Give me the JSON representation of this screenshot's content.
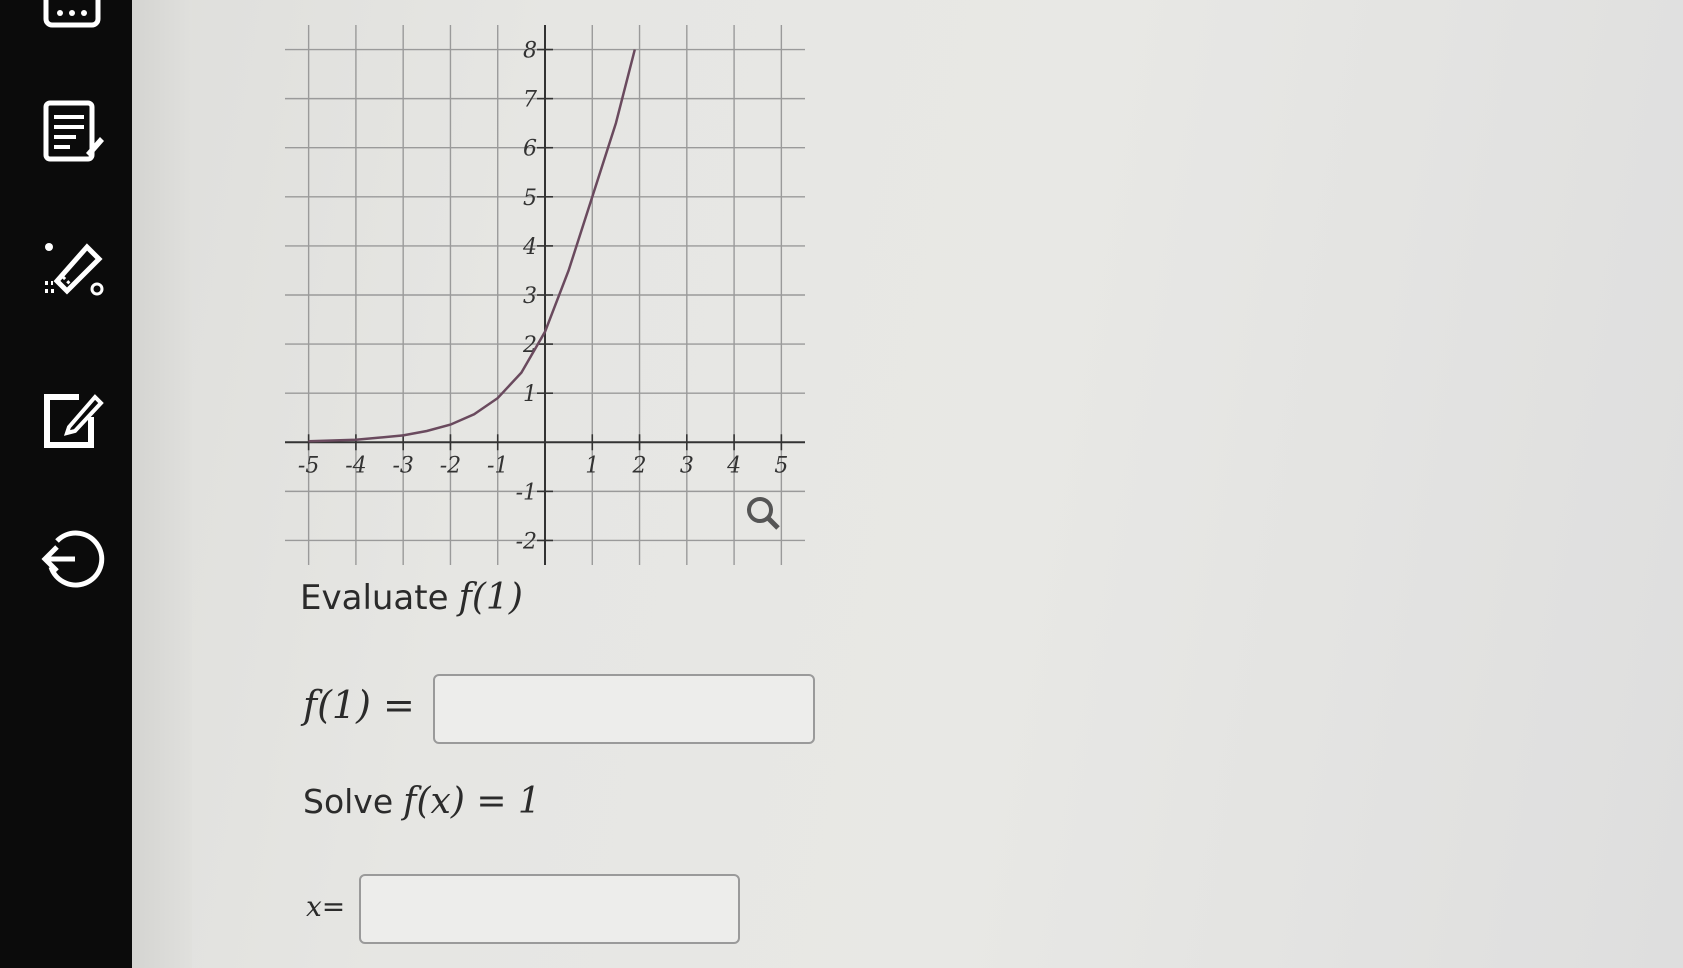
{
  "sidebar": {
    "icons": [
      {
        "name": "keyboard-icon"
      },
      {
        "name": "notes-icon"
      },
      {
        "name": "highlighter-icon"
      },
      {
        "name": "edit-icon"
      },
      {
        "name": "back-icon"
      }
    ]
  },
  "graph": {
    "x_tick_labels": [
      "-5",
      "-4",
      "-3",
      "-2",
      "-1",
      "1",
      "2",
      "3",
      "4",
      "5"
    ],
    "y_tick_labels": [
      "8",
      "7",
      "6",
      "5",
      "4",
      "3",
      "2",
      "1",
      "-1",
      "-2"
    ],
    "zoom_icon": "magnifier-icon"
  },
  "chart_data": {
    "type": "line",
    "xlim": [
      -5.5,
      5.5
    ],
    "ylim": [
      -2.5,
      8.5
    ],
    "grid": true,
    "x_ticks": [
      -5,
      -4,
      -3,
      -2,
      -1,
      1,
      2,
      3,
      4,
      5
    ],
    "y_ticks": [
      -2,
      -1,
      1,
      2,
      3,
      4,
      5,
      6,
      7,
      8
    ],
    "series": [
      {
        "x": [
          -5,
          -4,
          -3,
          -2.5,
          -2,
          -1.5,
          -1,
          -0.5,
          0,
          0.5,
          1,
          1.5,
          1.9
        ],
        "y": [
          0.02,
          0.05,
          0.14,
          0.23,
          0.36,
          0.57,
          0.9,
          1.42,
          2.25,
          3.5,
          5.0,
          6.5,
          8.0
        ]
      }
    ],
    "colors": {
      "curve": "#6a4a5e",
      "grid": "#9a9a9a",
      "axis": "#333333"
    }
  },
  "question": {
    "evaluate_word": "Evaluate",
    "evaluate_expr": "f(1)",
    "f1_label": "f(1) =",
    "solve_word": "Solve",
    "solve_expr": "f(x) = 1",
    "x_label": "x="
  },
  "inputs": {
    "f1_value": "",
    "x_value": ""
  }
}
